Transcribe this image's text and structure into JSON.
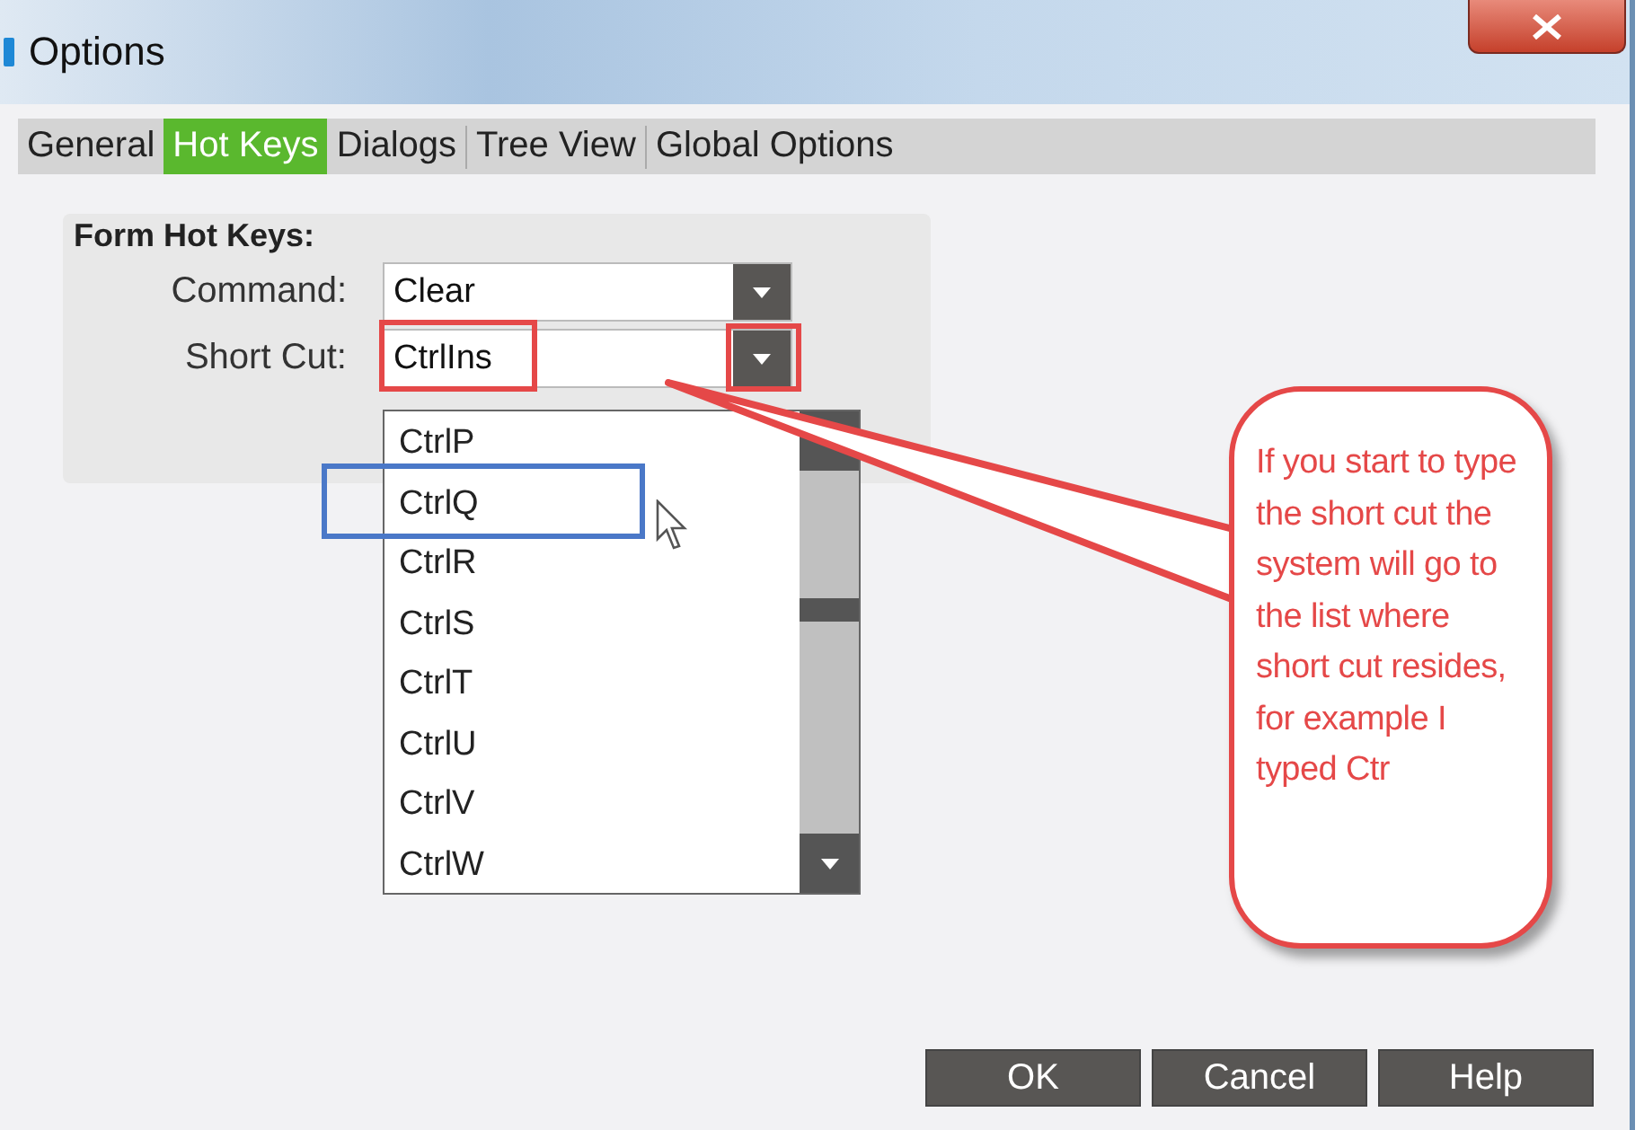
{
  "window": {
    "title": "Options"
  },
  "tabs": [
    {
      "label": "General",
      "selected": false
    },
    {
      "label": "Hot Keys",
      "selected": true
    },
    {
      "label": "Dialogs",
      "selected": false
    },
    {
      "label": "Tree View",
      "selected": false
    },
    {
      "label": "Global Options",
      "selected": false
    }
  ],
  "group": {
    "title": "Form Hot Keys:",
    "fields": [
      {
        "label": "Command:",
        "value": "Clear",
        "outlined": false
      },
      {
        "label": "Short Cut:",
        "value": "CtrlIns",
        "outlined": true
      }
    ]
  },
  "dropdown": {
    "items": [
      {
        "label": "CtrlP",
        "outlined": false
      },
      {
        "label": "CtrlQ",
        "outlined": true
      },
      {
        "label": "CtrlR",
        "outlined": false
      },
      {
        "label": "CtrlS",
        "outlined": false
      },
      {
        "label": "CtrlT",
        "outlined": false
      },
      {
        "label": "CtrlU",
        "outlined": false
      },
      {
        "label": "CtrlV",
        "outlined": false
      },
      {
        "label": "CtrlW",
        "outlined": false
      }
    ]
  },
  "callout": {
    "text": "If you start to type the short cut the system will go to the list where short cut resides, for example I typed Ctr"
  },
  "buttons": [
    "OK",
    "Cancel",
    "Help"
  ]
}
